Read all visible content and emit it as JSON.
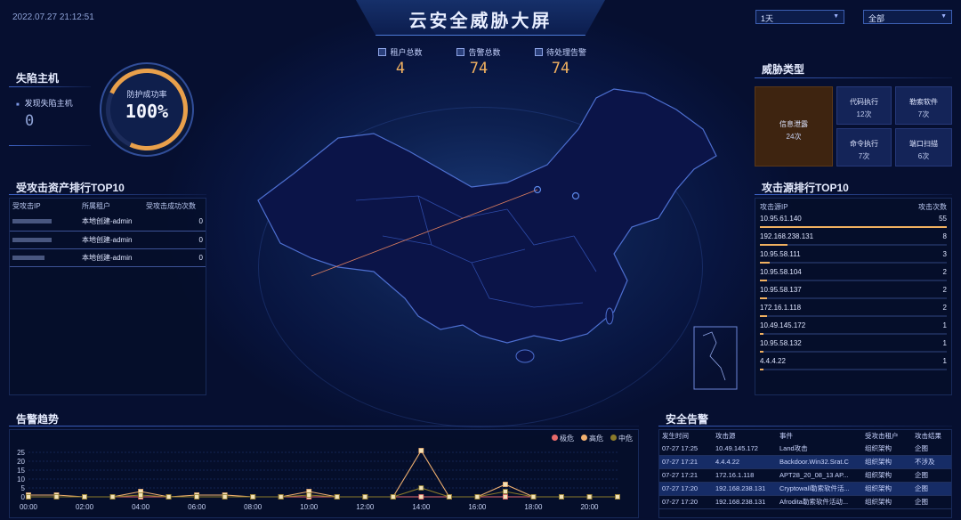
{
  "header": {
    "title": "云安全威胁大屏",
    "datetime": "2022.07.27 21:12:51",
    "period_select": "1天",
    "scope_select": "全部"
  },
  "stats": [
    {
      "label": "租户总数",
      "value": "4"
    },
    {
      "label": "告警总数",
      "value": "74"
    },
    {
      "label": "待处理告警",
      "value": "74"
    }
  ],
  "failed_hosts": {
    "title": "失陷主机",
    "label": "发现失陷主机",
    "value": "0",
    "gauge_label": "防护成功率",
    "gauge_value": "100%",
    "gauge_percent": 100
  },
  "top_assets": {
    "title": "受攻击资产排行TOP10",
    "headers": [
      "受攻击IP",
      "所属租户",
      "受攻击成功次数"
    ],
    "rows": [
      {
        "tenant": "本地创建-admin",
        "count": "0"
      },
      {
        "tenant": "本地创建-admin",
        "count": "0"
      },
      {
        "tenant": "本地创建-admin",
        "count": "0"
      }
    ]
  },
  "threat_types": {
    "title": "威胁类型",
    "main": {
      "name": "信息泄露",
      "count": "24次"
    },
    "tiles": [
      {
        "name": "代码执行",
        "count": "12次"
      },
      {
        "name": "勒索软件",
        "count": "7次"
      },
      {
        "name": "命令执行",
        "count": "7次"
      },
      {
        "name": "端口扫描",
        "count": "6次"
      }
    ],
    "colors": {
      "main": "#4a2a10",
      "tile": "#142458"
    }
  },
  "attack_sources": {
    "title": "攻击源排行TOP10",
    "headers": [
      "攻击源IP",
      "攻击次数"
    ],
    "rows": [
      {
        "ip": "10.95.61.140",
        "count": 55
      },
      {
        "ip": "192.168.238.131",
        "count": 8
      },
      {
        "ip": "10.95.58.111",
        "count": 3
      },
      {
        "ip": "10.95.58.104",
        "count": 2
      },
      {
        "ip": "10.95.58.137",
        "count": 2
      },
      {
        "ip": "172.16.1.118",
        "count": 2
      },
      {
        "ip": "10.49.145.172",
        "count": 1
      },
      {
        "ip": "10.95.58.132",
        "count": 1
      },
      {
        "ip": "4.4.4.22",
        "count": 1
      }
    ],
    "bar_color": "#f0b060"
  },
  "trend": {
    "title": "告警趋势",
    "legend": [
      {
        "name": "极危",
        "color": "#e86a6a"
      },
      {
        "name": "高危",
        "color": "#f0b070"
      },
      {
        "name": "中危",
        "color": "#8a7a2a"
      }
    ]
  },
  "chart_data": {
    "type": "line",
    "x": [
      "00:00",
      "01:00",
      "02:00",
      "03:00",
      "04:00",
      "05:00",
      "06:00",
      "07:00",
      "08:00",
      "09:00",
      "10:00",
      "11:00",
      "12:00",
      "13:00",
      "14:00",
      "15:00",
      "16:00",
      "17:00",
      "18:00",
      "19:00",
      "20:00",
      "21:00"
    ],
    "x_tick_labels": [
      "00:00",
      "02:00",
      "04:00",
      "06:00",
      "08:00",
      "10:00",
      "12:00",
      "14:00",
      "16:00",
      "18:00",
      "20:00"
    ],
    "ylim": [
      0,
      25
    ],
    "y_ticks": [
      0,
      5,
      10,
      15,
      20,
      25
    ],
    "series": [
      {
        "name": "极危",
        "values": [
          0,
          0,
          0,
          0,
          0,
          0,
          0,
          0,
          0,
          0,
          0,
          0,
          0,
          0,
          0,
          0,
          0,
          0,
          0,
          0,
          0,
          0
        ]
      },
      {
        "name": "高危",
        "values": [
          1,
          1,
          0,
          0,
          3,
          0,
          1,
          1,
          0,
          0,
          3,
          0,
          0,
          0,
          26,
          0,
          0,
          7,
          0,
          0,
          0,
          0
        ]
      },
      {
        "name": "中危",
        "values": [
          0,
          0,
          0,
          0,
          1,
          0,
          0,
          0,
          0,
          0,
          1,
          0,
          0,
          0,
          5,
          0,
          0,
          3,
          0,
          0,
          0,
          0
        ]
      }
    ]
  },
  "security_alerts": {
    "title": "安全告警",
    "headers": [
      "发生时间",
      "攻击源",
      "事件",
      "受攻击租户",
      "攻击结果"
    ],
    "rows": [
      {
        "time": "07-27 17:25",
        "src": "10.49.145.172",
        "event": "Land攻击",
        "tenant": "组织架构",
        "result": "企图"
      },
      {
        "time": "07-27 17:21",
        "src": "4.4.4.22",
        "event": "Backdoor.Win32.Srat.C",
        "tenant": "组织架构",
        "result": "不涉及"
      },
      {
        "time": "07-27 17:21",
        "src": "172.16.1.118",
        "event": "APT28_20_08_13 AP...",
        "tenant": "组织架构",
        "result": "企图"
      },
      {
        "time": "07-27 17:20",
        "src": "192.168.238.131",
        "event": "Cryptowall勒索软件活...",
        "tenant": "组织架构",
        "result": "企图"
      },
      {
        "time": "07-27 17:20",
        "src": "192.168.238.131",
        "event": "Afrodita勒索软件活动...",
        "tenant": "组织架构",
        "result": "企图"
      }
    ]
  }
}
